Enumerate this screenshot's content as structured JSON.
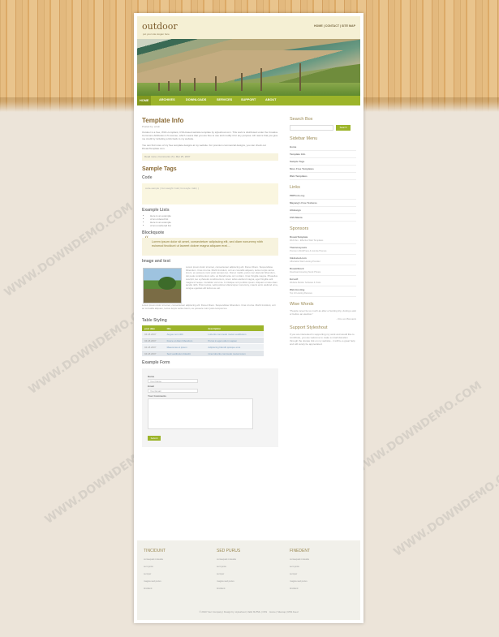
{
  "header": {
    "logo": "outdoor",
    "tagline": "put your site slogan here",
    "topnav": "HOME | CONTACT | SITE MAP"
  },
  "nav": {
    "items": [
      "HOME",
      "ARCHIVES",
      "DOWNLOADS",
      "SERVICES",
      "SUPPORT",
      "ABOUT"
    ]
  },
  "main": {
    "title": "Template Info",
    "posted_by": "Posted by: erwin",
    "intro": "Outdoor is a free, W3C-compliant, CSS-based website template by styleshout.com. This work is distributed under the Creative Commons Attribution 2.5 License, which means that you are free to use and modify it for any purpose. All I ask is that you give me credit by including a link back to my website.",
    "more": "You can find more of my free template designs at my website. For premium commercial designs, you can check out DreamTemplate.com.",
    "postmeta": "Read more  |  Comments (7)  |  Mar 25, 2007",
    "sample_title": "Sample Tags",
    "code_heading": "Code",
    "code_text": "code-sample { font-weight: bold; font-style: italic; }",
    "lists_heading": "Example Lists",
    "list_items": [
      "Here is an example",
      "of an ordered list",
      "Here is an example",
      "of an unordered list"
    ],
    "blockquote_heading": "Blockquote",
    "blockquote": "Lorem ipsum dolor sit amet, consectetuer adipiscing elit, sed diam nonummy nibh euismod tincidunt ut laoreet dolore magna aliquam erat....",
    "image_heading": "Image and text",
    "image_text": "Lorem ipsum dolor sit amet, consectetuer adipiscing elit. Donec libero. Suspendisse bibendum. Cras id urna. Morbi tincidunt, orci ac convallis aliquam, lectus turpis varius lorem, eu posuere nunc justo tempus leo. Donec mattis, purus nec placerat bibendum, dui pede condimentum odio, ac blandit ante orci ut diam. Cras fringilla magna. Phasellus suscipit, leo a pharetra condimentum, lorem tellus eleifend magna, eget fringilla velit magna id neque. Curabitur vel urna. In tristique orci porttitor ipsum. Aliquam ornare diam iaculis nibh. Proin luctus, velit pulvinar ullamcorper nonummy, mauris enim eleifend urna, congue egestas elit lectus eu est.",
    "image_text2": "Lorem ipsum dolor sit amet, consectetuer adipiscing elit. Donec libero. Suspendisse bibendum. Cras id urna. Morbi tincidunt, orci ac convallis aliquam, lectus turpis varius lorem, eu posuere nunc justo tempus leo.",
    "table_heading": "Table Styling",
    "table_headers": [
      "post date",
      "title",
      "description"
    ],
    "table_rows": [
      [
        "04.18.2007",
        "Augue non nibh",
        "Lobortis commodo metus vestibulum"
      ],
      [
        "04.18.2007",
        "Fusce ut diam bibendum",
        "Purus in eget odio in sapien"
      ],
      [
        "04.18.2007",
        "Maecenas et ipsum",
        "Adipiscing blandit quisque eros"
      ],
      [
        "04.18.2007",
        "Sed vestibulum blandit",
        "Cras lobortis commodo metus lorem"
      ]
    ],
    "form_heading": "Example Form",
    "form": {
      "name_label": "Name",
      "name_value": "Your Name",
      "email_label": "Email",
      "email_value": "Your Email",
      "comments_label": "Your Comments",
      "submit": "Submit"
    }
  },
  "sidebar": {
    "search_heading": "Search Box",
    "search_button": "Search",
    "menu_heading": "Sidebar Menu",
    "menu_items": [
      "Home",
      "Template Info",
      "Sample Tags",
      "More Free Templates",
      "Web Templates"
    ],
    "links_heading": "Links",
    "links": [
      "PDPhoto.org",
      "Mayang's Free Textures",
      "Altdesign",
      "CSS Mania"
    ],
    "sponsors_heading": "Sponsors",
    "sponsors": [
      {
        "name": "DreamTemplate",
        "sub": "Web Dev - Effective Web Templates"
      },
      {
        "name": "ThemeLayouts",
        "sub": "Premium WordPress & Joomla Themes"
      },
      {
        "name": "ImHosted.com",
        "sub": "Affordable Web Hosting Provider"
      },
      {
        "name": "DreamStock",
        "sub": "Download Amazing Stock Photos"
      },
      {
        "name": "Evrsoft",
        "sub": "Website Builder Software & Tools"
      },
      {
        "name": "Web Hosting",
        "sub": "Top 10 Hosting Reviews"
      }
    ],
    "wise_heading": "Wise Words",
    "wise_text": "\"People never lie so much as after a hunting trip, during a war or before an election.\"",
    "wise_attr": "- Otto von Bismarck",
    "support_heading": "Support Styleshout",
    "support_text": "If you are interested in supporting my work and would like to contribute, you are welcome to make a small donation through the donate link on my website - it will be a great help and will surely be appreciated."
  },
  "footer": {
    "col1_heading": "TINCIDUNT",
    "col2_heading": "SED PURUS",
    "col3_heading": "FINEDENT",
    "col_items": [
      "consequat molestie",
      "sem justo",
      "semper",
      "magna sed purus",
      "tincidunt"
    ],
    "copyright": "© 2010 Your Company  |  Design by: styleshout  |  Valid XHTML | CSS",
    "footer_links": "Home | Sitemap | RSS Feed"
  },
  "watermark": "WWW.DOWNDEMO.COM"
}
